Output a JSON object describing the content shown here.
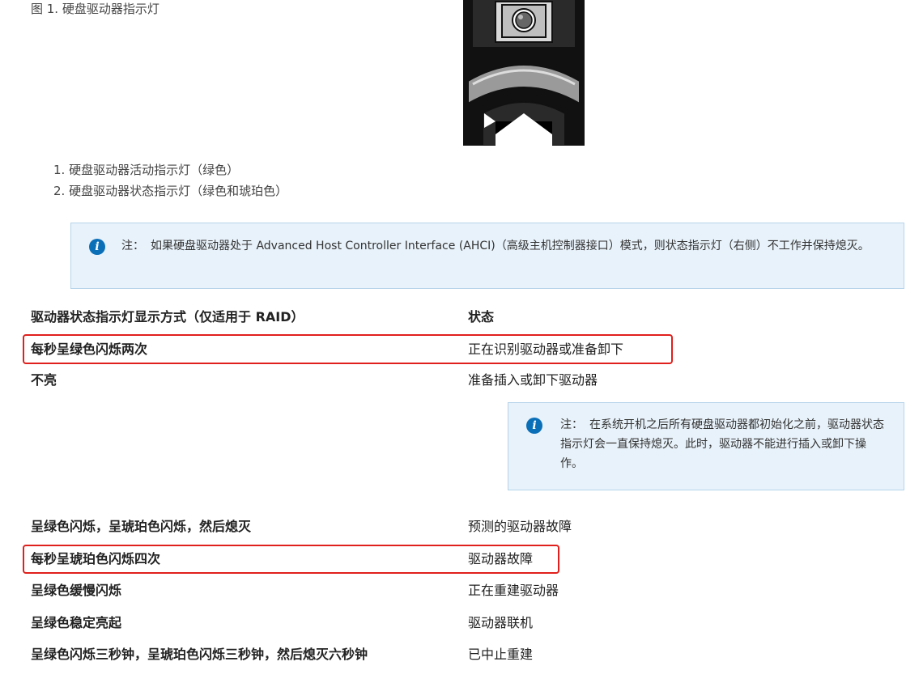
{
  "figure": {
    "caption": "图 1. 硬盘驱动器指示灯"
  },
  "callouts": [
    "1. 硬盘驱动器活动指示灯（绿色）",
    "2. 硬盘驱动器状态指示灯（绿色和琥珀色）"
  ],
  "note1": {
    "icon": "info-icon",
    "label": "注：",
    "text": "如果硬盘驱动器处于 Advanced Host Controller Interface (AHCI)（高级主机控制器接口）模式，则状态指示灯（右侧）不工作并保持熄灭。"
  },
  "table": {
    "header": {
      "pattern": "驱动器状态指示灯显示方式（仅适用于 RAID）",
      "status": "状态"
    },
    "rows": [
      {
        "pattern": "每秒呈绿色闪烁两次",
        "status": "正在识别驱动器或准备卸下",
        "highlighted": true
      },
      {
        "pattern": "不亮",
        "status": "准备插入或卸下驱动器",
        "highlighted": false
      },
      {
        "pattern": "呈绿色闪烁，呈琥珀色闪烁，然后熄灭",
        "status": "预测的驱动器故障",
        "highlighted": false
      },
      {
        "pattern": "每秒呈琥珀色闪烁四次",
        "status": "驱动器故障",
        "highlighted": true
      },
      {
        "pattern": "呈绿色缓慢闪烁",
        "status": "正在重建驱动器",
        "highlighted": false
      },
      {
        "pattern": "呈绿色稳定亮起",
        "status": "驱动器联机",
        "highlighted": false
      },
      {
        "pattern": "呈绿色闪烁三秒钟，呈琥珀色闪烁三秒钟，然后熄灭六秒钟",
        "status": "已中止重建",
        "highlighted": false
      }
    ]
  },
  "note2": {
    "icon": "info-icon",
    "label": "注：",
    "text": "在系统开机之后所有硬盘驱动器都初始化之前，驱动器状态指示灯会一直保持熄灭。此时，驱动器不能进行插入或卸下操作。"
  },
  "colors": {
    "highlight_border": "#e0201c",
    "note_background": "#e8f2fa",
    "note_border": "#b7d4ea",
    "info_icon": "#0b6fb8"
  }
}
